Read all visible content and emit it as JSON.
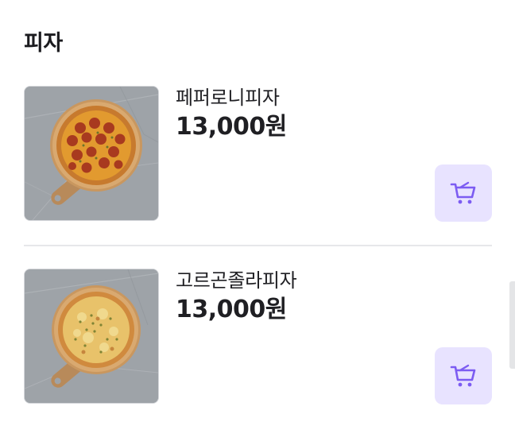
{
  "category": {
    "title": "피자"
  },
  "items": [
    {
      "name": "페퍼로니피자",
      "price": "13,000원",
      "image_icon": "pepperoni-pizza-image",
      "cart_icon": "shopping-cart-icon"
    },
    {
      "name": "고르곤졸라피자",
      "price": "13,000원",
      "image_icon": "gorgonzola-pizza-image",
      "cart_icon": "shopping-cart-icon"
    }
  ],
  "colors": {
    "cart_button_bg": "#e8e3ff",
    "cart_icon": "#7c5cf2",
    "text": "#1f1f23",
    "divider": "#e6e7ea"
  }
}
